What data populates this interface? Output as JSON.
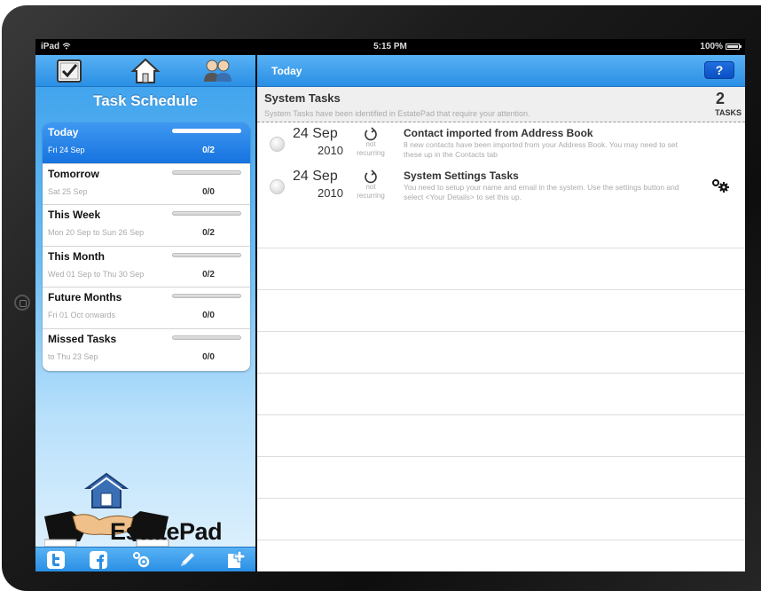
{
  "status_bar": {
    "carrier": "iPad",
    "time": "5:15 PM",
    "battery": "100%"
  },
  "left_panel": {
    "title": "Task Schedule",
    "top_icons": [
      "checkbox-icon",
      "home-icon",
      "contacts-icon"
    ],
    "periods": [
      {
        "name": "Today",
        "date": "Fri 24 Sep",
        "count": "0/2",
        "progress": 0,
        "active": true
      },
      {
        "name": "Tomorrow",
        "date": "Sat 25 Sep",
        "count": "0/0",
        "progress": 0
      },
      {
        "name": "This Week",
        "date": "Mon 20 Sep to Sun 26 Sep",
        "count": "0/2",
        "progress": 0
      },
      {
        "name": "This Month",
        "date": "Wed 01 Sep to Thu 30 Sep",
        "count": "0/2",
        "progress": 0
      },
      {
        "name": "Future Months",
        "date": "Fri 01 Oct onwards",
        "count": "0/0",
        "progress": 0
      },
      {
        "name": "Missed Tasks",
        "date": "to Thu 23 Sep",
        "count": "0/0",
        "progress": 0
      }
    ],
    "logo_text": "EstatePad",
    "bottom_icons": [
      "twitter-icon",
      "facebook-icon",
      "settings-icon",
      "edit-icon",
      "add-icon"
    ]
  },
  "right_panel": {
    "nav_title": "Today",
    "help_label": "?",
    "section": {
      "title": "System Tasks",
      "description": "System Tasks have been identified in EstatePad that require your attention.",
      "count": "2",
      "count_label": "TASKS"
    },
    "tasks": [
      {
        "day": "24 Sep",
        "year": "2010",
        "recur_line1": "not",
        "recur_line2": "recurring",
        "title": "Contact imported from Address Book",
        "description": "8 new contacts have been imported from your Address Book. You may need to set these up in the Contacts tab"
      },
      {
        "day": "24 Sep",
        "year": "2010",
        "recur_line1": "not",
        "recur_line2": "recurring",
        "title": "System Settings Tasks",
        "description": "You need to setup your name and email in the system. Use the settings button and select <Your Details> to set this up."
      }
    ]
  },
  "colors": {
    "accent": "#2a8fe4",
    "active_row": "#1673e0",
    "help_button": "#0b4fc4"
  }
}
